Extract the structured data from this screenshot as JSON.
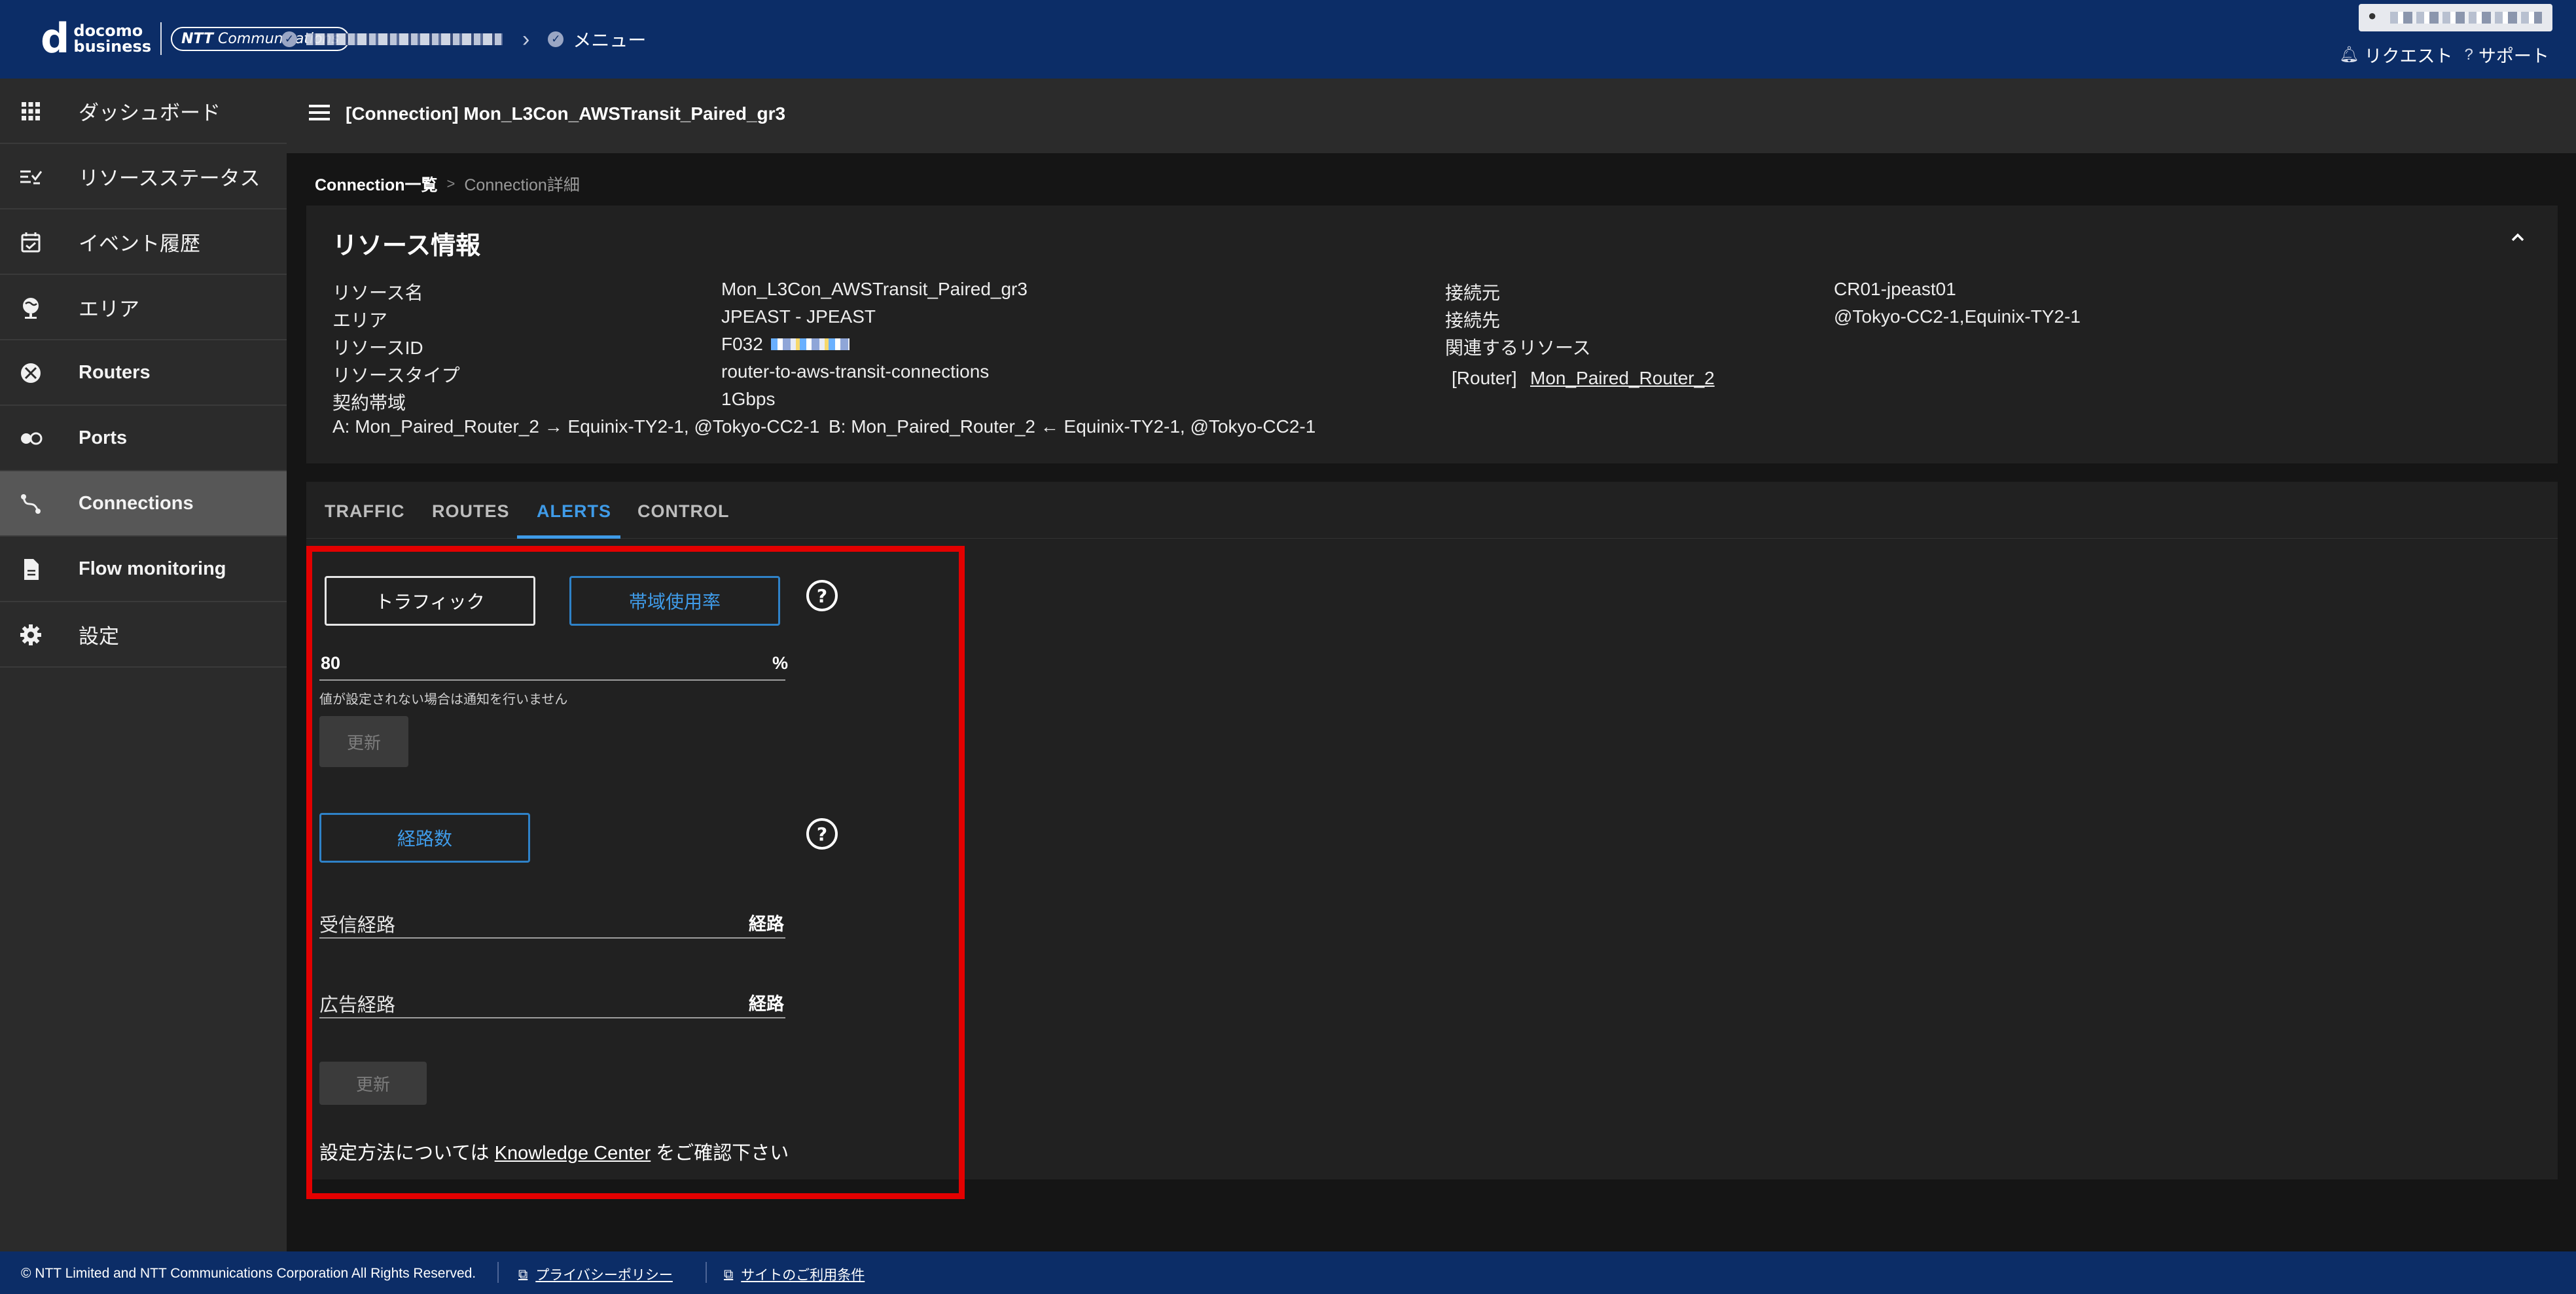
{
  "header": {
    "logo": {
      "mark": "d",
      "line1": "docomo",
      "line2": "business",
      "partner": "NTT Communications",
      "partner_bold": "NTT"
    },
    "menu_label": "メニュー",
    "request_label": "リクエスト",
    "support_label": "サポート"
  },
  "sidebar": {
    "items": [
      {
        "label": "ダッシュボード",
        "icon": "grid-icon"
      },
      {
        "label": "リソースステータス",
        "icon": "list-check-icon"
      },
      {
        "label": "イベント履歴",
        "icon": "calendar-check-icon"
      },
      {
        "label": "エリア",
        "icon": "globe-pin-icon"
      },
      {
        "label": "Routers",
        "icon": "router-icon"
      },
      {
        "label": "Ports",
        "icon": "port-icon"
      },
      {
        "label": "Connections",
        "icon": "connection-icon"
      },
      {
        "label": "Flow monitoring",
        "icon": "document-icon"
      },
      {
        "label": "設定",
        "icon": "gear-icon"
      }
    ]
  },
  "page": {
    "title": "[Connection] Mon_L3Con_AWSTransit_Paired_gr3"
  },
  "breadcrumb": {
    "parent": "Connection一覧",
    "separator": ">",
    "current": "Connection詳細"
  },
  "resource_info": {
    "heading": "リソース情報",
    "rows_left": [
      {
        "label": "リソース名",
        "value": "Mon_L3Con_AWSTransit_Paired_gr3"
      },
      {
        "label": "エリア",
        "value": "JPEAST - JPEAST"
      },
      {
        "label": "リソースID",
        "value": "F032"
      },
      {
        "label": "リソースタイプ",
        "value": "router-to-aws-transit-connections"
      },
      {
        "label": "契約帯域",
        "value": "1Gbps"
      }
    ],
    "path_a": "A: Mon_Paired_Router_2 → Equinix-TY2-1, @Tokyo-CC2-1",
    "path_b": "B: Mon_Paired_Router_2 ← Equinix-TY2-1, @Tokyo-CC2-1",
    "rows_right": [
      {
        "label": "接続元",
        "value": "CR01-jpeast01"
      },
      {
        "label": "接続先",
        "value": "@Tokyo-CC2-1,Equinix-TY2-1"
      },
      {
        "label": "関連するリソース",
        "value": ""
      }
    ],
    "related_prefix": "[Router]",
    "related_link": "Mon_Paired_Router_2"
  },
  "tabs": [
    "TRAFFIC",
    "ROUTES",
    "ALERTS",
    "CONTROL"
  ],
  "active_tab": "ALERTS",
  "alerts": {
    "traffic_button": "トラフィック",
    "bandwidth_button": "帯域使用率",
    "threshold_value": "80",
    "threshold_unit": "%",
    "hint": "値が設定されない場合は通知を行いません",
    "update_label": "更新",
    "routes_button": "経路数",
    "received_label": "受信経路",
    "received_unit": "経路",
    "advertised_label": "広告経路",
    "advertised_unit": "経路",
    "update_label_2": "更新",
    "note_prefix": "設定方法については",
    "note_link": "Knowledge Center",
    "note_suffix": "をご確認下さい"
  },
  "footer": {
    "copyright": "© NTT Limited and NTT Communications Corporation All Rights Reserved.",
    "privacy": "プライバシーポリシー",
    "terms": "サイトのご利用条件"
  },
  "colors": {
    "header_bg": "#0c2d67",
    "sidebar_bg": "#2b2b2b",
    "panel_bg": "#212121",
    "accent_blue": "#3f9be8",
    "highlight_red": "#e30000"
  }
}
